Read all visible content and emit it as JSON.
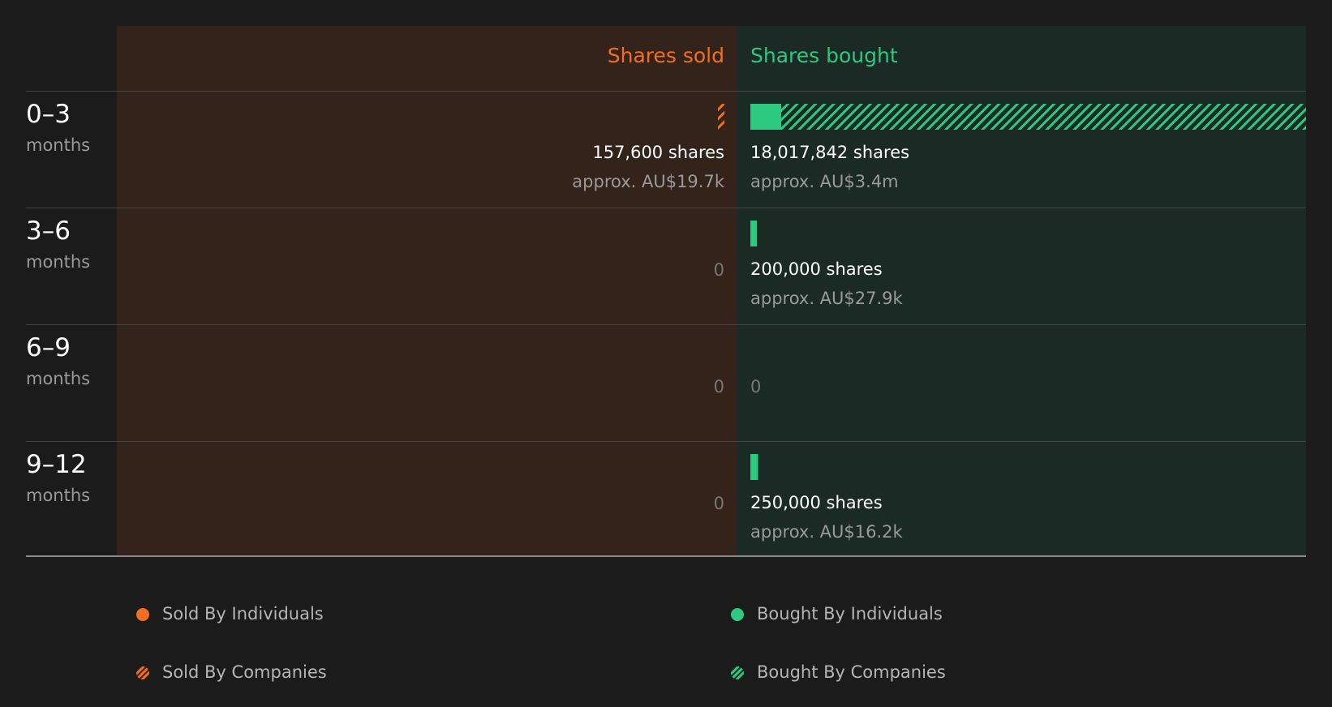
{
  "colors": {
    "sold": "#f26f21",
    "bought": "#2dc97e",
    "sold_bg": "#33231b",
    "bought_bg": "#1b2a24"
  },
  "chart_data": {
    "type": "bar",
    "headers": {
      "sold": "Shares sold",
      "bought": "Shares bought"
    },
    "categories": [
      {
        "range": "0–3",
        "unit": "months"
      },
      {
        "range": "3–6",
        "unit": "months"
      },
      {
        "range": "6–9",
        "unit": "months"
      },
      {
        "range": "9–12",
        "unit": "months"
      }
    ],
    "scale_max": 18017842,
    "sold": [
      {
        "shares": 157600,
        "shares_label": "157,600 shares",
        "value_label": "approx. AU$19.7k",
        "individuals": 0,
        "companies": 157600
      },
      {
        "shares": 0,
        "zero_label": "0"
      },
      {
        "shares": 0,
        "zero_label": "0"
      },
      {
        "shares": 0,
        "zero_label": "0"
      }
    ],
    "bought": [
      {
        "shares": 18017842,
        "shares_label": "18,017,842 shares",
        "value_label": "approx. AU$3.4m",
        "individuals": 1000000,
        "companies": 17017842
      },
      {
        "shares": 200000,
        "shares_label": "200,000 shares",
        "value_label": "approx. AU$27.9k",
        "individuals": 200000,
        "companies": 0
      },
      {
        "shares": 0,
        "zero_label": "0"
      },
      {
        "shares": 250000,
        "shares_label": "250,000 shares",
        "value_label": "approx. AU$16.2k",
        "individuals": 250000,
        "companies": 0
      }
    ],
    "legend": [
      {
        "label": "Sold By Individuals",
        "style": "solid-orange"
      },
      {
        "label": "Bought By Individuals",
        "style": "solid-green"
      },
      {
        "label": "Sold By Companies",
        "style": "hatch-orange"
      },
      {
        "label": "Bought By Companies",
        "style": "hatch-green"
      }
    ]
  }
}
